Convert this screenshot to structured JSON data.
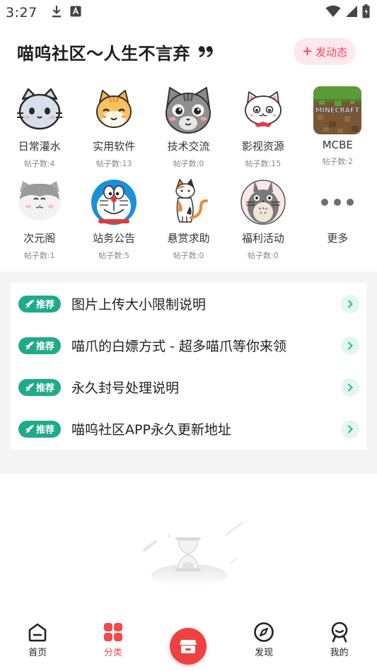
{
  "status": {
    "time": "3:27",
    "icons": [
      "download-icon",
      "app-a-icon",
      "wifi-icon",
      "signal-icon",
      "battery-icon"
    ]
  },
  "header": {
    "title": "喵呜社区～人生不言弃",
    "post_button": "发动态"
  },
  "categories": [
    {
      "name": "日常灌水",
      "count": "帖子数:4",
      "icon": "gray-cat-icon"
    },
    {
      "name": "实用软件",
      "count": "帖子数:13",
      "icon": "orange-cat-icon"
    },
    {
      "name": "技术交流",
      "count": "帖子数:0",
      "icon": "tabby-cat-icon"
    },
    {
      "name": "影视资源",
      "count": "帖子数:15",
      "icon": "white-cat-icon"
    },
    {
      "name": "MCBE",
      "count": "帖子数:2",
      "icon": "minecraft-icon"
    },
    {
      "name": "次元阁",
      "count": "帖子数:1",
      "icon": "fluffy-cat-icon"
    },
    {
      "name": "站务公告",
      "count": "帖子数:5",
      "icon": "doraemon-icon"
    },
    {
      "name": "悬赏求助",
      "count": "帖子数:0",
      "icon": "calico-cat-icon"
    },
    {
      "name": "福利活动",
      "count": "帖子数:0",
      "icon": "totoro-icon"
    },
    {
      "name": "更多",
      "count": "",
      "icon": "more-dots-icon"
    }
  ],
  "notices": {
    "badge_label": "推荐",
    "items": [
      "图片上传大小限制说明",
      "喵爪的白嫖方式 - 超多喵爪等你来领",
      "永久封号处理说明",
      "喵呜社区APP永久更新地址"
    ]
  },
  "minecraft_logo_text": "MINECRAFT",
  "nav": {
    "home": "首页",
    "categories": "分类",
    "discover": "发现",
    "mine": "我的"
  },
  "colors": {
    "accent_red": "#f04a4a",
    "badge_green": "#1fab89",
    "post_button_bg": "#fde8ec",
    "section_gray": "#f4f4f4"
  }
}
